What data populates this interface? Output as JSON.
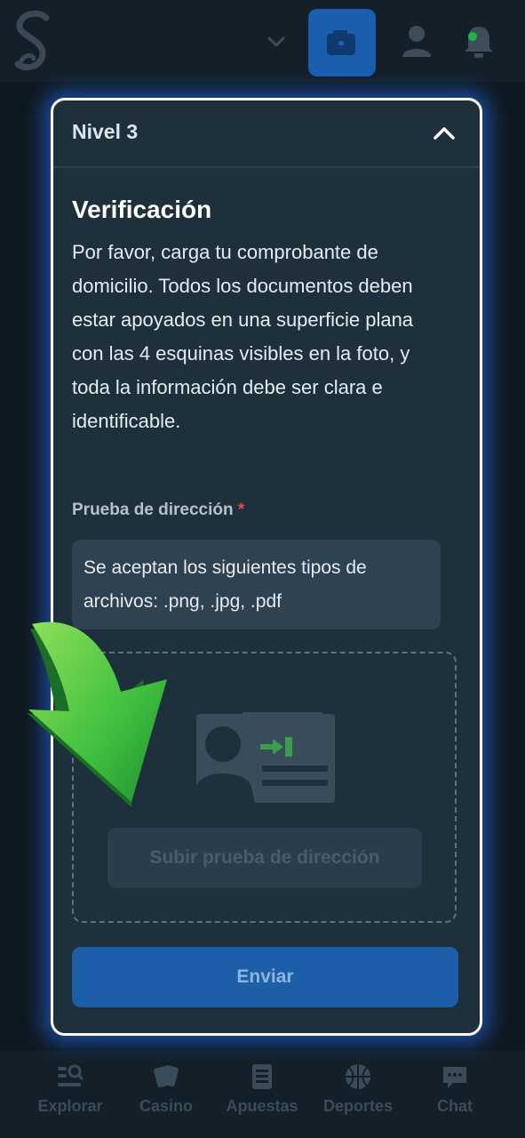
{
  "header": {
    "logo_letter": "S",
    "icons": [
      "chevron-down-icon",
      "wallet-icon",
      "user-icon",
      "bell-icon"
    ],
    "accent_color": "#1a5fae",
    "notification_dot_color": "#22b24c"
  },
  "modal": {
    "title": "Nivel 3",
    "heading": "Verificación",
    "description": "Por favor, carga tu comprobante de domicilio. Todos los documentos deben estar apoyados en una superficie plana con las 4 esquinas visibles en la foto, y toda la información debe ser clara e identificable.",
    "field_label": "Prueba de dirección",
    "required_mark": "*",
    "accepted_types": "Se aceptan los siguientes tipos de archivos: .png, .jpg, .pdf",
    "upload_label": "Subir prueba de dirección",
    "submit_label": "Enviar"
  },
  "bottom_nav": [
    {
      "label": "Explorar",
      "icon": "search-list-icon"
    },
    {
      "label": "Casino",
      "icon": "cards-icon"
    },
    {
      "label": "Apuestas",
      "icon": "betslip-icon"
    },
    {
      "label": "Deportes",
      "icon": "basketball-icon"
    },
    {
      "label": "Chat",
      "icon": "chat-icon"
    }
  ],
  "overlay": {
    "arrow_color": "#3fbf3f"
  }
}
